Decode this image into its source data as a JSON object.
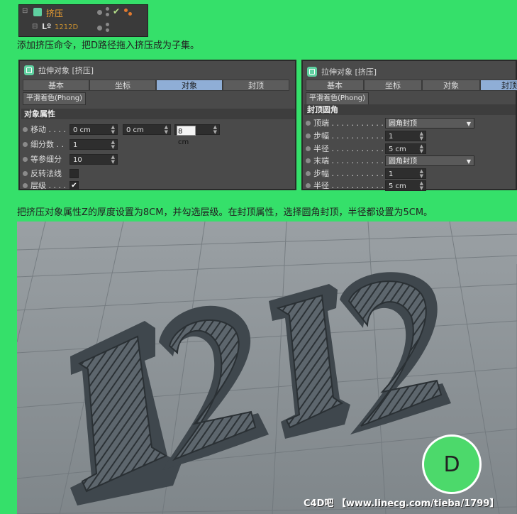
{
  "object_manager": {
    "row1_name": "挤压",
    "row2_name": "1212D"
  },
  "caption1": "添加挤压命令，把D路径拖入挤压成为子集。",
  "panel_left": {
    "title": "拉伸对象 [挤压]",
    "tabs": [
      "基本",
      "坐标",
      "对象",
      "封顶"
    ],
    "active_tab": "对象",
    "phong_button": "平滑着色(Phong)",
    "section": "对象属性",
    "fields": {
      "move_label": "移动 . . . .",
      "move_x": "0 cm",
      "move_y": "0 cm",
      "move_z": "8 cm",
      "subdiv_label": "细分数 . .",
      "subdiv_value": "1",
      "iso_label": "等参细分",
      "iso_value": "10",
      "flip_label": "反转法线",
      "hier_label": "层级 . . . .",
      "hier_checked": "✔"
    }
  },
  "panel_right": {
    "title": "拉伸对象 [挤压]",
    "tabs": [
      "基本",
      "坐标",
      "对象",
      "封顶"
    ],
    "active_tab": "封顶",
    "phong_button": "平滑着色(Phong)",
    "section": "封顶圆角",
    "rows": [
      {
        "label": "顶端 . . . . . . . . . . . . .",
        "value": "圆角封顶",
        "kind": "select"
      },
      {
        "label": "步幅 . . . . . . . . . . . . .",
        "value": "1",
        "kind": "field"
      },
      {
        "label": "半径 . . . . . . . . . . . . .",
        "value": "5 cm",
        "kind": "field"
      },
      {
        "label": "末端 . . . . . . . . . . . . .",
        "value": "圆角封顶",
        "kind": "select"
      },
      {
        "label": "步幅 . . . . . . . . . . . . .",
        "value": "1",
        "kind": "field"
      },
      {
        "label": "半径 . . . . . . . . . . . . .",
        "value": "5 cm",
        "kind": "field"
      }
    ]
  },
  "caption2": "把挤压对象属性Z的厚度设置为8CM，并勾选层级。在封顶属性，选择圆角封顶，半径都设置为5CM。",
  "viewport": {
    "badge_letter": "D",
    "watermark": "C4D吧 【www.linecg.com/tieba/1799】"
  },
  "colors": {
    "page_bg": "#35e06a",
    "panel_bg": "#4a4a4a",
    "active_tab": "#8faed6",
    "badge_fill": "#4cd96b",
    "viewport_bg": "#8d9397"
  }
}
